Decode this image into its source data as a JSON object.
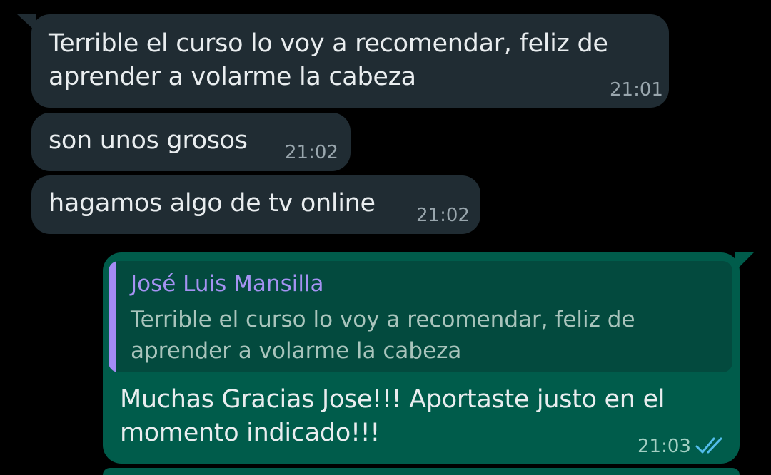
{
  "messages": [
    {
      "direction": "incoming",
      "lines": [
        "Terrible el curso lo voy a recomendar, feliz de",
        "aprender a volarme la cabeza"
      ],
      "time": "21:01"
    },
    {
      "direction": "incoming",
      "lines": [
        "son unos grosos"
      ],
      "time": "21:02"
    },
    {
      "direction": "incoming",
      "lines": [
        "hagamos algo de tv online"
      ],
      "time": "21:02"
    },
    {
      "direction": "outgoing",
      "quote": {
        "author": "José Luis Mansilla",
        "lines": [
          "Terrible el curso lo voy a recomendar, feliz de",
          "aprender a volarme la cabeza"
        ]
      },
      "lines": [
        "Muchas Gracias Jose!!! Aportaste justo en el",
        "momento indicado!!!"
      ],
      "time": "21:03",
      "status_icon": "double-check-read-icon"
    }
  ],
  "colors": {
    "background": "#000000",
    "incoming_bubble": "#202C33",
    "outgoing_bubble": "#005C4B",
    "quote_background": "#034A3E",
    "quote_accent": "#A592F2",
    "read_ticks": "#53BDEB"
  }
}
